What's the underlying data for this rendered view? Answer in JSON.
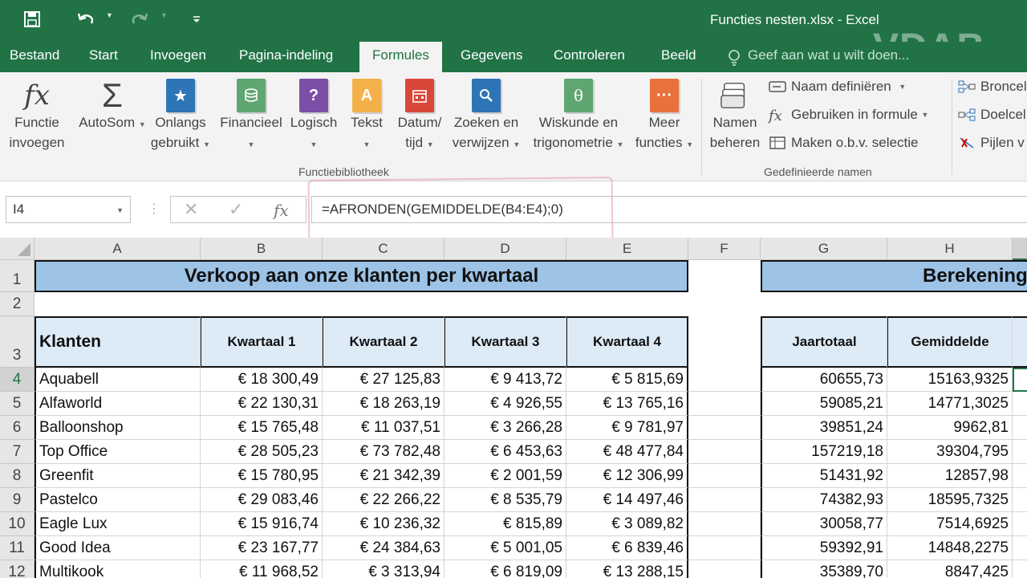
{
  "titlebar": {
    "title": "Functies nesten.xlsx - Excel",
    "watermark": "VDAB",
    "bg": "#217346"
  },
  "qat": {
    "save_icon": "save-icon",
    "undo_icon": "undo-icon",
    "redo_icon": "redo-icon",
    "customize_icon": "customize-qat-icon"
  },
  "tabs": [
    {
      "label": "Bestand"
    },
    {
      "label": "Start"
    },
    {
      "label": "Invoegen"
    },
    {
      "label": "Pagina-indeling"
    },
    {
      "label": "Formules",
      "active": true
    },
    {
      "label": "Gegevens"
    },
    {
      "label": "Controleren"
    },
    {
      "label": "Beeld"
    }
  ],
  "tellme": {
    "text": "Geef aan wat u wilt doen..."
  },
  "ribbon": {
    "insert_function": {
      "line1": "Functie",
      "line2": "invoegen"
    },
    "autosum": {
      "label": "AutoSom"
    },
    "recent": {
      "line1": "Onlangs",
      "line2": "gebruikt"
    },
    "financial": {
      "label": "Financieel"
    },
    "logical": {
      "label": "Logisch"
    },
    "text": {
      "label": "Tekst"
    },
    "datetime": {
      "line1": "Datum/",
      "line2": "tijd"
    },
    "lookup": {
      "line1": "Zoeken en",
      "line2": "verwijzen"
    },
    "math": {
      "line1": "Wiskunde en",
      "line2": "trigonometrie"
    },
    "more": {
      "line1": "Meer",
      "line2": "functies"
    },
    "group_library": "Functiebibliotheek",
    "name_manager": {
      "line1": "Namen",
      "line2": "beheren"
    },
    "define_name": "Naam definiëren",
    "use_in_formula": "Gebruiken in formule",
    "create_from_selection": "Maken o.b.v. selectie",
    "group_names": "Gedefinieerde namen",
    "trace_precedents": "Broncel",
    "trace_dependents": "Doelcel",
    "remove_arrows": "Pijlen v"
  },
  "formula_bar": {
    "name_box": "I4",
    "formula": "=AFRONDEN(GEMIDDELDE(B4:E4);0)"
  },
  "columns": [
    "A",
    "B",
    "C",
    "D",
    "E",
    "F",
    "G",
    "H"
  ],
  "sheet": {
    "title_left": "Verkoop aan onze klanten per kwartaal",
    "title_right": "Berekening",
    "headers": {
      "a": "Klanten",
      "b": "Kwartaal 1",
      "c": "Kwartaal 2",
      "d": "Kwartaal 3",
      "e": "Kwartaal 4",
      "g": "Jaartotaal",
      "h": "Gemiddelde"
    },
    "rows": [
      {
        "num": "4",
        "a": "Aquabell",
        "b": "€ 18 300,49",
        "c": "€ 27 125,83",
        "d": "€ 9 413,72",
        "e": "€ 5 815,69",
        "g": "60655,73",
        "h": "15163,9325"
      },
      {
        "num": "5",
        "a": "Alfaworld",
        "b": "€ 22 130,31",
        "c": "€ 18 263,19",
        "d": "€ 4 926,55",
        "e": "€ 13 765,16",
        "g": "59085,21",
        "h": "14771,3025"
      },
      {
        "num": "6",
        "a": "Balloonshop",
        "b": "€ 15 765,48",
        "c": "€ 11 037,51",
        "d": "€ 3 266,28",
        "e": "€ 9 781,97",
        "g": "39851,24",
        "h": "9962,81"
      },
      {
        "num": "7",
        "a": "Top Office",
        "b": "€ 28 505,23",
        "c": "€ 73 782,48",
        "d": "€ 6 453,63",
        "e": "€ 48 477,84",
        "g": "157219,18",
        "h": "39304,795"
      },
      {
        "num": "8",
        "a": "Greenfit",
        "b": "€ 15 780,95",
        "c": "€ 21 342,39",
        "d": "€ 2 001,59",
        "e": "€ 12 306,99",
        "g": "51431,92",
        "h": "12857,98"
      },
      {
        "num": "9",
        "a": "Pastelco",
        "b": "€ 29 083,46",
        "c": "€ 22 266,22",
        "d": "€ 8 535,79",
        "e": "€ 14 497,46",
        "g": "74382,93",
        "h": "18595,7325"
      },
      {
        "num": "10",
        "a": "Eagle Lux",
        "b": "€ 15 916,74",
        "c": "€ 10 236,32",
        "d": "€ 815,89",
        "e": "€ 3 089,82",
        "g": "30058,77",
        "h": "7514,6925"
      },
      {
        "num": "11",
        "a": "Good Idea",
        "b": "€ 23 167,77",
        "c": "€ 24 384,63",
        "d": "€ 5 001,05",
        "e": "€ 6 839,46",
        "g": "59392,91",
        "h": "14848,2275"
      },
      {
        "num": "12",
        "a": "Multikook",
        "b": "€ 11 968,52",
        "c": "€ 3 313,94",
        "d": "€ 6 819,09",
        "e": "€ 13 288,15",
        "g": "35389,70",
        "h": "8847,425"
      }
    ]
  },
  "row_numbers": {
    "r1": "1",
    "r2": "2",
    "r3": "3"
  },
  "colors": {
    "accent": "#217346",
    "band": "#9dc3e6",
    "header_fill": "#ddebf7"
  }
}
